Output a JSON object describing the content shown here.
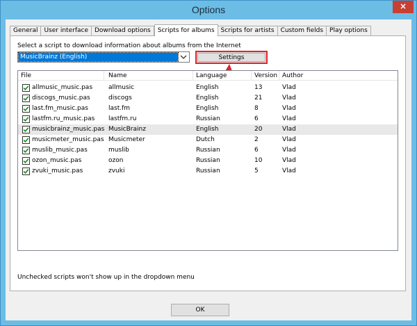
{
  "window": {
    "title": "Options",
    "close_glyph": "×"
  },
  "tabs": [
    {
      "label": "General",
      "active": false
    },
    {
      "label": "User interface",
      "active": false
    },
    {
      "label": "Download options",
      "active": false
    },
    {
      "label": "Scripts for albums",
      "active": true
    },
    {
      "label": "Scripts for artists",
      "active": false
    },
    {
      "label": "Custom fields",
      "active": false
    },
    {
      "label": "Play options",
      "active": false
    }
  ],
  "panel": {
    "instruction": "Select a script to download information about albums from the Internet",
    "selected_script": "MusicBrainz (English)",
    "settings_label": "Settings",
    "footnote": "Unchecked scripts won't show up in the dropdown menu"
  },
  "list": {
    "columns": [
      "File",
      "Name",
      "Language",
      "Version",
      "Author"
    ],
    "rows": [
      {
        "file": "allmusic_music.pas",
        "name": "allmusic",
        "language": "English",
        "version": "13",
        "author": "Vlad",
        "checked": true
      },
      {
        "file": "discogs_music.pas",
        "name": "discogs",
        "language": "English",
        "version": "21",
        "author": "Vlad",
        "checked": true
      },
      {
        "file": "last.fm_music.pas",
        "name": "last.fm",
        "language": "English",
        "version": "8",
        "author": "Vlad",
        "checked": true
      },
      {
        "file": "lastfm.ru_music.pas",
        "name": "lastfm.ru",
        "language": "Russian",
        "version": "6",
        "author": "Vlad",
        "checked": true
      },
      {
        "file": "musicbrainz_music.pas",
        "name": "MusicBrainz",
        "language": "English",
        "version": "20",
        "author": "Vlad",
        "checked": true,
        "highlighted": true
      },
      {
        "file": "musicmeter_music.pas",
        "name": "Musicmeter",
        "language": "Dutch",
        "version": "2",
        "author": "Vlad",
        "checked": true
      },
      {
        "file": "muslib_music.pas",
        "name": "muslib",
        "language": "Russian",
        "version": "6",
        "author": "Vlad",
        "checked": true
      },
      {
        "file": "ozon_music.pas",
        "name": "ozon",
        "language": "Russian",
        "version": "10",
        "author": "Vlad",
        "checked": true
      },
      {
        "file": "zvuki_music.pas",
        "name": "zvuki",
        "language": "Russian",
        "version": "5",
        "author": "Vlad",
        "checked": true
      }
    ]
  },
  "footer": {
    "ok_label": "OK"
  },
  "icons": {
    "close": "close-icon",
    "dropdown": "chevron-down-icon",
    "checkbox": "checkmark-icon",
    "annotation": "red-arrow-icon"
  },
  "colors": {
    "titlebar": "#6bbde6",
    "selection": "#0078d7",
    "highlight_border": "#e0242a",
    "check": "#1a8a1a"
  }
}
